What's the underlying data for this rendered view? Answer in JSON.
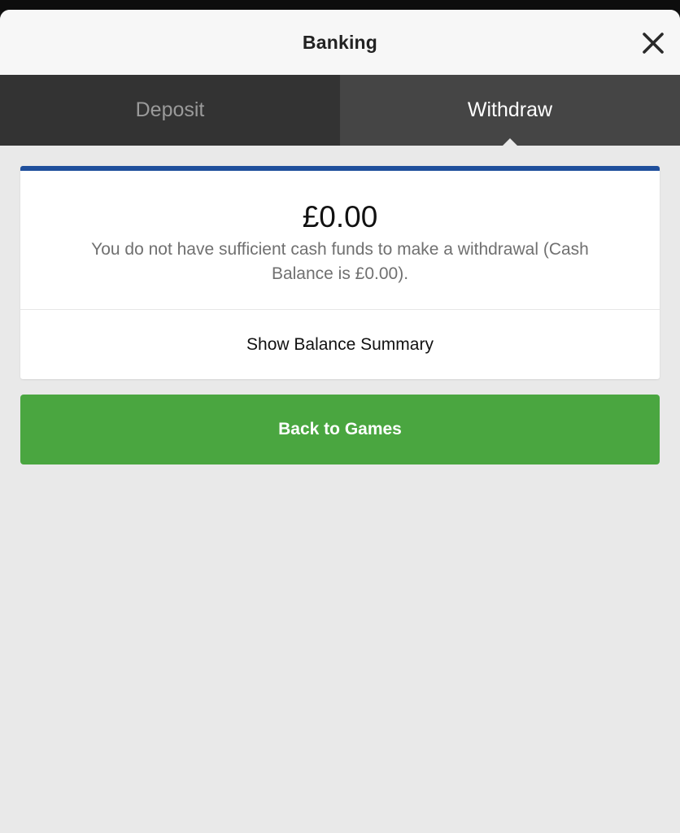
{
  "header": {
    "title": "Banking",
    "close_icon": "close-icon"
  },
  "tabs": [
    {
      "label": "Deposit",
      "active": false
    },
    {
      "label": "Withdraw",
      "active": true
    }
  ],
  "withdraw": {
    "amount": "£0.00",
    "message": "You do not have sufficient cash funds to make a withdrawal (Cash Balance is £0.00).",
    "summary_label": "Show Balance Summary",
    "back_label": "Back to Games"
  },
  "colors": {
    "accent_blue": "#1f4f9c",
    "button_green": "#4aa640",
    "tab_bar": "#333333",
    "tab_active": "#454545"
  }
}
